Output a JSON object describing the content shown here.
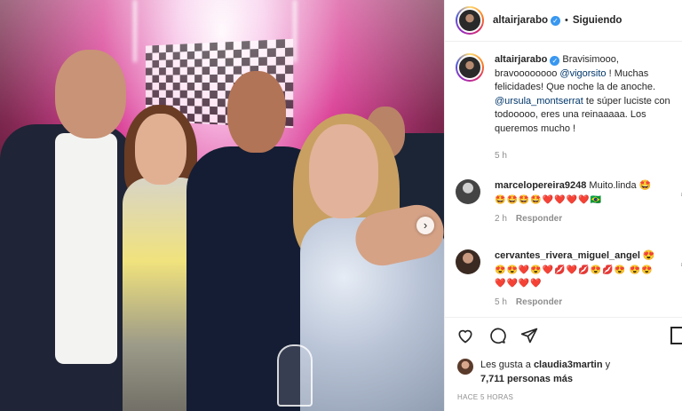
{
  "post": {
    "username": "altairjarabo",
    "follow_status": "Siguiendo",
    "separator": "•",
    "verified_glyph": "✓"
  },
  "caption": {
    "username": "altairjarabo",
    "text_1": " Bravisimooo, bravoooooooo ",
    "mention_1": "@vigorsito",
    "text_2": " ! Muchas felicidades! Que noche la de anoche. ",
    "mention_2": "@ursula_montserrat",
    "text_3": " te súper luciste con todooooo, eres una reinaaaaa. Los queremos mucho !",
    "time": "5 h"
  },
  "comments": [
    {
      "username": "marcelopereira9248",
      "text": " Muito.linda 🤩",
      "emojis": "🤩🤩🤩🤩❤️❤️❤️❤️🇧🇷",
      "time": "2 h",
      "reply_label": "Responder"
    },
    {
      "username": "cervantes_rivera_miguel_angel",
      "text": " 😍",
      "emojis": "😍😍❤️😍❤️💋❤️💋😍💋😍 😍😍❤️❤️❤️❤️",
      "time": "5 h",
      "reply_label": "Responder"
    }
  ],
  "actions": {
    "like_icon": "heart-icon",
    "comment_icon": "comment-icon",
    "share_icon": "share-icon",
    "save_icon": "bookmark-icon"
  },
  "likes": {
    "prefix": "Les gusta a ",
    "user": "claudia3martin",
    "suffix": " y",
    "count_text": "7,711 personas más"
  },
  "posted_ago": "HACE 5 HORAS",
  "colors": {
    "link": "#00376b",
    "verified": "#3897f0",
    "muted": "#8e8e8e"
  }
}
